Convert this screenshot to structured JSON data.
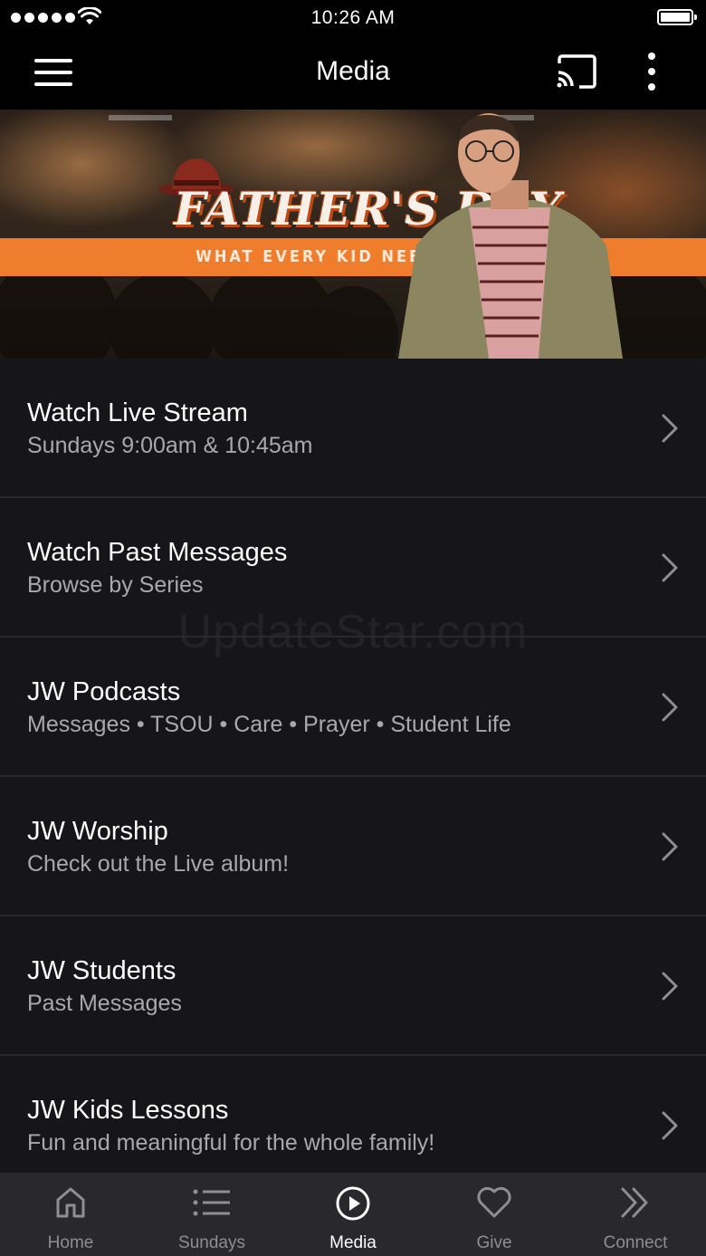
{
  "status_bar": {
    "time": "10:26 AM"
  },
  "nav": {
    "title": "Media"
  },
  "hero": {
    "title": "FATHER'S DAY",
    "subtitle": "WHAT EVERY KID NEEDS TO HEAR",
    "band_color": "#f07d2c"
  },
  "list": {
    "items": [
      {
        "title": "Watch Live Stream",
        "subtitle": "Sundays 9:00am & 10:45am"
      },
      {
        "title": "Watch Past Messages",
        "subtitle": "Browse by Series"
      },
      {
        "title": "JW Podcasts",
        "subtitle": "Messages • TSOU • Care • Prayer • Student Life"
      },
      {
        "title": "JW Worship",
        "subtitle": "Check out the Live album!"
      },
      {
        "title": "JW Students",
        "subtitle": "Past Messages"
      },
      {
        "title": "JW Kids Lessons",
        "subtitle": "Fun and meaningful for the whole family!"
      }
    ]
  },
  "watermark": "UpdateStar.com",
  "tabs": [
    {
      "label": "Home",
      "icon": "home-icon"
    },
    {
      "label": "Sundays",
      "icon": "list-icon"
    },
    {
      "label": "Media",
      "icon": "play-circle-icon",
      "active": true
    },
    {
      "label": "Give",
      "icon": "heart-icon"
    },
    {
      "label": "Connect",
      "icon": "double-chevron-icon"
    }
  ],
  "colors": {
    "active_tab": "#ffffff",
    "inactive_tab": "#8e8e93",
    "accent": "#f07d2c"
  }
}
